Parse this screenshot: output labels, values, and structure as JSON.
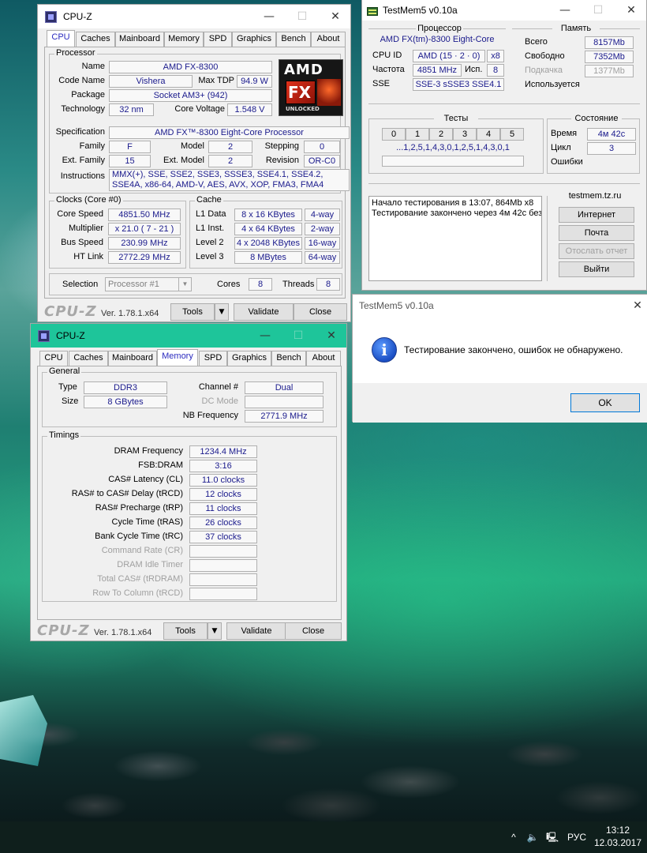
{
  "cpuz1": {
    "title": "CPU-Z",
    "tabs": [
      "CPU",
      "Caches",
      "Mainboard",
      "Memory",
      "SPD",
      "Graphics",
      "Bench",
      "About"
    ],
    "processor": {
      "group": "Processor",
      "name_label": "Name",
      "name": "AMD FX-8300",
      "codename_label": "Code Name",
      "codename": "Vishera",
      "maxtdp_label": "Max TDP",
      "maxtdp": "94.9 W",
      "package_label": "Package",
      "package": "Socket AM3+ (942)",
      "technology_label": "Technology",
      "technology": "32 nm",
      "corevoltage_label": "Core Voltage",
      "corevoltage": "1.548 V",
      "spec_label": "Specification",
      "spec": "AMD FX™-8300 Eight-Core Processor",
      "family_label": "Family",
      "family": "F",
      "model_label": "Model",
      "model": "2",
      "stepping_label": "Stepping",
      "stepping": "0",
      "extfamily_label": "Ext. Family",
      "extfamily": "15",
      "extmodel_label": "Ext. Model",
      "extmodel": "2",
      "revision_label": "Revision",
      "revision": "OR-C0",
      "instructions_label": "Instructions",
      "instructions": "MMX(+), SSE, SSE2, SSE3, SSSE3, SSE4.1, SSE4.2, SSE4A, x86-64, AMD-V, AES, AVX, XOP, FMA3, FMA4",
      "logo": {
        "amd": "AMD",
        "fx": "FX",
        "unlocked": "UNLOCKED"
      }
    },
    "clocks": {
      "group": "Clocks (Core #0)",
      "corespeed_label": "Core Speed",
      "corespeed": "4851.50 MHz",
      "multiplier_label": "Multiplier",
      "multiplier": "x 21.0 ( 7 - 21 )",
      "busspeed_label": "Bus Speed",
      "busspeed": "230.99 MHz",
      "htlink_label": "HT Link",
      "htlink": "2772.29 MHz"
    },
    "cache": {
      "group": "Cache",
      "l1data_label": "L1 Data",
      "l1data": "8 x 16 KBytes",
      "l1data_way": "4-way",
      "l1inst_label": "L1 Inst.",
      "l1inst": "4 x 64 KBytes",
      "l1inst_way": "2-way",
      "l2_label": "Level 2",
      "l2": "4 x 2048 KBytes",
      "l2_way": "16-way",
      "l3_label": "Level 3",
      "l3": "8 MBytes",
      "l3_way": "64-way"
    },
    "selection_label": "Selection",
    "selection": "Processor #1",
    "cores_label": "Cores",
    "cores": "8",
    "threads_label": "Threads",
    "threads": "8",
    "logo": "CPU-Z",
    "version": "Ver. 1.78.1.x64",
    "tools": "Tools",
    "validate": "Validate",
    "close": "Close"
  },
  "cpuz2": {
    "title": "CPU-Z",
    "tabs": [
      "CPU",
      "Caches",
      "Mainboard",
      "Memory",
      "SPD",
      "Graphics",
      "Bench",
      "About"
    ],
    "general": {
      "group": "General",
      "type_label": "Type",
      "type": "DDR3",
      "size_label": "Size",
      "size": "8 GBytes",
      "channel_label": "Channel #",
      "channel": "Dual",
      "dcmode_label": "DC Mode",
      "dcmode": "",
      "nbfreq_label": "NB Frequency",
      "nbfreq": "2771.9 MHz"
    },
    "timings": {
      "group": "Timings",
      "rows": [
        {
          "label": "DRAM Frequency",
          "value": "1234.4 MHz",
          "dis": false
        },
        {
          "label": "FSB:DRAM",
          "value": "3:16",
          "dis": false
        },
        {
          "label": "CAS# Latency (CL)",
          "value": "11.0 clocks",
          "dis": false
        },
        {
          "label": "RAS# to CAS# Delay (tRCD)",
          "value": "12 clocks",
          "dis": false
        },
        {
          "label": "RAS# Precharge (tRP)",
          "value": "11 clocks",
          "dis": false
        },
        {
          "label": "Cycle Time (tRAS)",
          "value": "26 clocks",
          "dis": false
        },
        {
          "label": "Bank Cycle Time (tRC)",
          "value": "37 clocks",
          "dis": false
        },
        {
          "label": "Command Rate (CR)",
          "value": "",
          "dis": true
        },
        {
          "label": "DRAM Idle Timer",
          "value": "",
          "dis": true
        },
        {
          "label": "Total CAS# (tRDRAM)",
          "value": "",
          "dis": true
        },
        {
          "label": "Row To Column (tRCD)",
          "value": "",
          "dis": true
        }
      ]
    },
    "logo": "CPU-Z",
    "version": "Ver. 1.78.1.x64",
    "tools": "Tools",
    "validate": "Validate",
    "close": "Close"
  },
  "testmem": {
    "title": "TestMem5 v0.10a",
    "cpu": {
      "head": "Процессор",
      "name": "AMD FX(tm)-8300 Eight-Core",
      "cpuid_label": "CPU ID",
      "cpuid": "AMD  (15 · 2 · 0)",
      "cpuid_x": "x8",
      "freq_label": "Частота",
      "freq": "4851 MHz",
      "threads_label": "Исп.",
      "threads": "8",
      "sse_label": "SSE",
      "sse": "SSE-3 sSSE3 SSE4.1"
    },
    "mem": {
      "head": "Память",
      "total_label": "Всего",
      "total": "8157Mb",
      "free_label": "Свободно",
      "free": "7352Mb",
      "swap_label": "Подкачка",
      "swap": "1377Mb",
      "used_label": "Используется",
      "used": ""
    },
    "tests": {
      "head": "Тесты",
      "numbers": [
        "0",
        "1",
        "2",
        "3",
        "4",
        "5"
      ],
      "sequence": "...1,2,5,1,4,3,0,1,2,5,1,4,3,0,1"
    },
    "state": {
      "head": "Состояние",
      "time_label": "Время",
      "time": "4м 42с",
      "cycle_label": "Цикл",
      "cycle": "3",
      "errors_label": "Ошибки",
      "errors": ""
    },
    "log": [
      "Начало тестирования в 13:07, 864Mb x8",
      "Тестирование закончено через 4м 42с без"
    ],
    "site": {
      "head": "testmem.tz.ru",
      "internet": "Интернет",
      "mail": "Почта",
      "send": "Отослать отчет",
      "exit": "Выйти"
    }
  },
  "dialog": {
    "title": "TestMem5 v0.10a",
    "message": "Тестирование закончено, ошибок не обнаружено.",
    "ok": "OK"
  },
  "taskbar": {
    "lang": "РУС",
    "time": "13:12",
    "date": "12.03.2017",
    "chevron": "^"
  }
}
